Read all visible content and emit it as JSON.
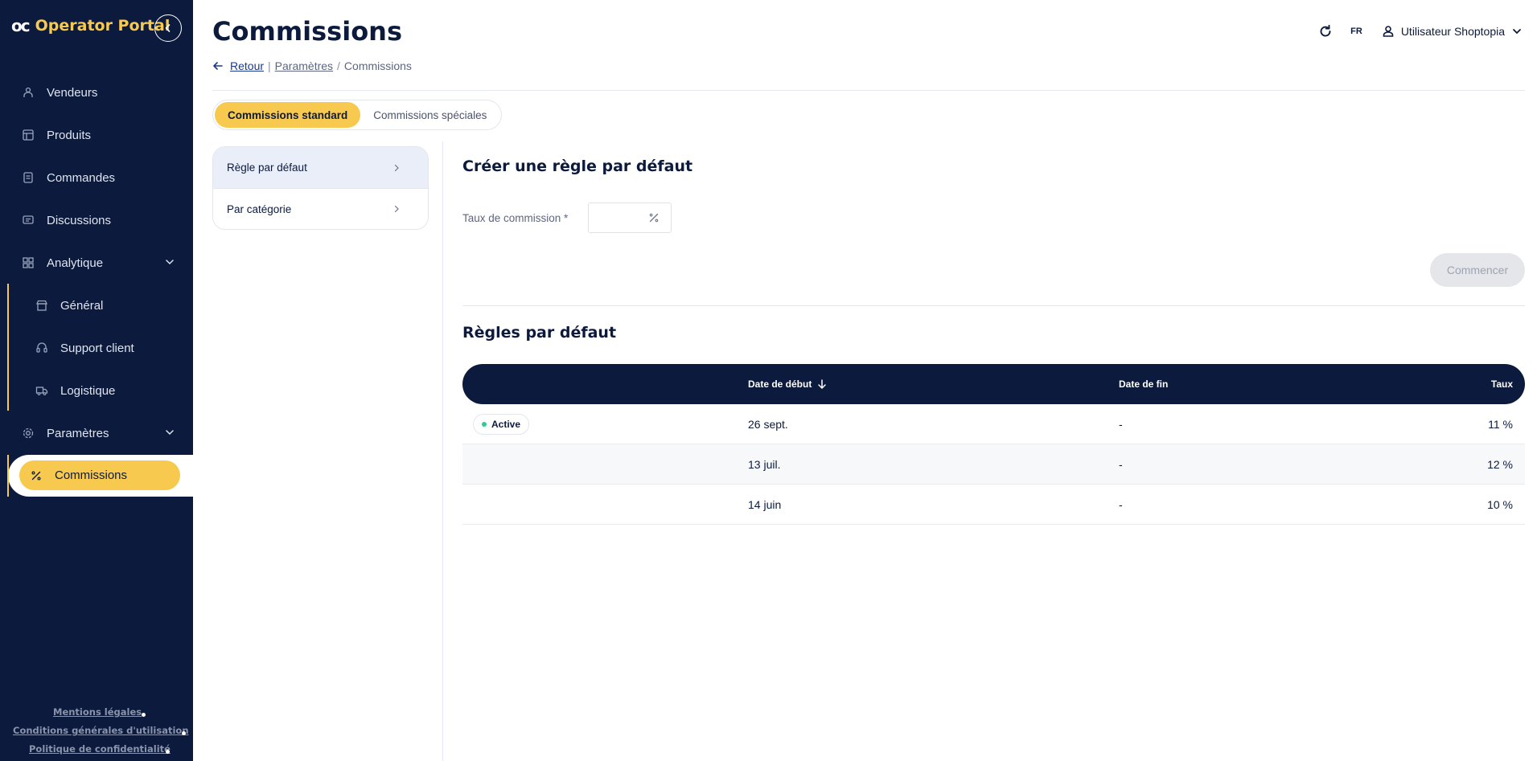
{
  "brand": {
    "logo": "oc",
    "name": "Operator Portal"
  },
  "sidebar": {
    "items": [
      {
        "label": "Vendeurs"
      },
      {
        "label": "Produits"
      },
      {
        "label": "Commandes"
      },
      {
        "label": "Discussions"
      },
      {
        "label": "Analytique"
      },
      {
        "label": "Général"
      },
      {
        "label": "Support client"
      },
      {
        "label": "Logistique"
      },
      {
        "label": "Paramètres"
      },
      {
        "label": "Commissions"
      }
    ],
    "footer": [
      {
        "label": "Mentions légales"
      },
      {
        "label": "Conditions générales d'utilisation"
      },
      {
        "label": "Politique de confidentialité"
      }
    ]
  },
  "header": {
    "title": "Commissions",
    "lang": "FR",
    "user": "Utilisateur Shoptopia"
  },
  "breadcrumb": {
    "back": "Retour",
    "separator": "|",
    "parent": "Paramètres",
    "slash": "/",
    "current": "Commissions"
  },
  "tabs": [
    {
      "label": "Commissions standard",
      "active": true
    },
    {
      "label": "Commissions spéciales",
      "active": false
    }
  ],
  "left_menu": [
    {
      "label": "Règle par défaut",
      "selected": true
    },
    {
      "label": "Par catégorie",
      "selected": false
    }
  ],
  "form": {
    "title": "Créer une règle par défaut",
    "rate_label": "Taux de commission *",
    "rate_value": "",
    "submit": "Commencer"
  },
  "rules": {
    "title": "Règles par défaut",
    "columns": {
      "status": "",
      "start": "Date de début",
      "end": "Date de fin",
      "rate": "Taux"
    },
    "rows": [
      {
        "status": "Active",
        "start": "26 sept.",
        "end": "-",
        "rate": "11 %"
      },
      {
        "status": "",
        "start": "13 juil.",
        "end": "-",
        "rate": "12 %"
      },
      {
        "status": "",
        "start": "14 juin",
        "end": "-",
        "rate": "10 %"
      }
    ]
  },
  "colors": {
    "navy": "#0b1a3d",
    "accent": "#f8c94f",
    "active_dot": "#2ecc8f"
  }
}
